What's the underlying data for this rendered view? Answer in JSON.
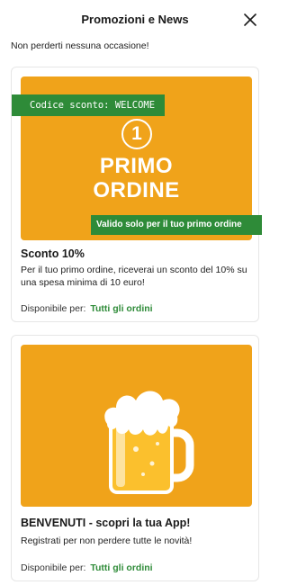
{
  "header": {
    "title": "Promozioni e News",
    "close_icon": "close-icon"
  },
  "subtitle": "Non perderti nessuna occasione!",
  "colors": {
    "accent_green": "#2e8b38",
    "promo_orange": "#f0a31a"
  },
  "promos": [
    {
      "code_label": "Codice sconto: WELCOME",
      "image_number": "1",
      "image_line1": "PRIMO",
      "image_line2": "ORDINE",
      "valid_label": "Valido solo per il tuo primo ordine",
      "title": "Sconto 10%",
      "description": "Per il tuo primo ordine, riceverai un sconto del 10% su una spesa minima di 10 euro!",
      "availability_label": "Disponibile per:",
      "availability_value": "Tutti gli ordini"
    },
    {
      "image_icon": "beer-mug-icon",
      "title": "BENVENUTI - scopri la tua App!",
      "description": "Registrati per non perdere tutte le novità!",
      "availability_label": "Disponibile per:",
      "availability_value": "Tutti gli ordini"
    }
  ]
}
